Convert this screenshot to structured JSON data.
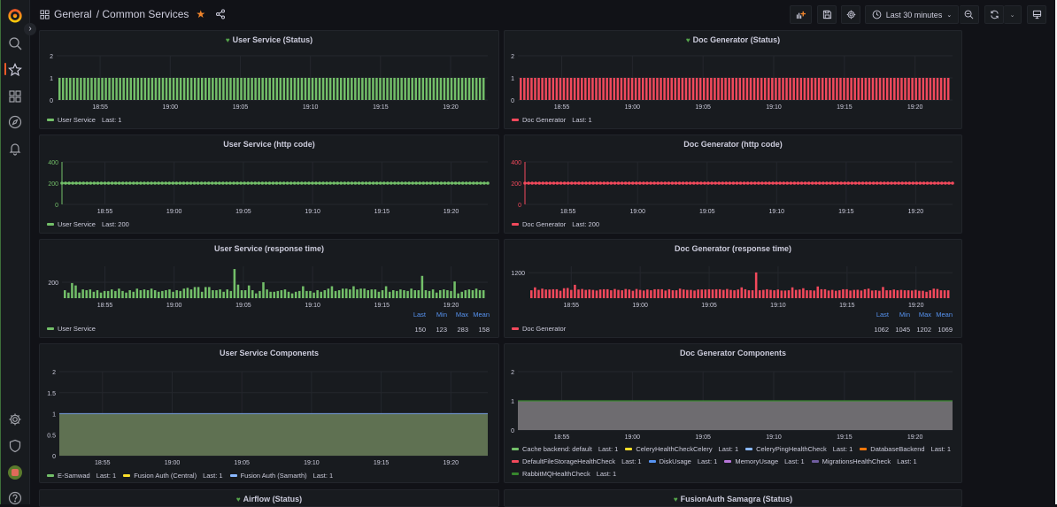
{
  "header": {
    "folder": "General",
    "title": "/ Common Services",
    "starred": true,
    "time_range": "Last 30 minutes"
  },
  "sidebar": {
    "items": [
      {
        "icon": "search-icon",
        "label": "Search"
      },
      {
        "icon": "star-icon",
        "label": "Starred",
        "active": true
      },
      {
        "icon": "dashboards-icon",
        "label": "Dashboards"
      },
      {
        "icon": "compass-icon",
        "label": "Explore"
      },
      {
        "icon": "bell-icon",
        "label": "Alerting"
      },
      {
        "icon": "gear-icon",
        "label": "Configuration"
      },
      {
        "icon": "shield-icon",
        "label": "Server Admin"
      },
      {
        "icon": "avatar",
        "label": "Profile"
      },
      {
        "icon": "help-icon",
        "label": "Help"
      }
    ]
  },
  "colors": {
    "green": "#73bf69",
    "red": "#f2495c",
    "accent": "#f05a28",
    "legend_header": "#5794f2"
  },
  "x_ticks": [
    "18:55",
    "19:00",
    "19:05",
    "19:10",
    "19:15",
    "19:20"
  ],
  "chart_data": [
    {
      "id": "user-status",
      "type": "bar",
      "title": "User Service (Status)",
      "heart": true,
      "color": "#73bf69",
      "ylim": [
        0,
        2
      ],
      "yticks": [
        "0",
        "1",
        "2"
      ],
      "series": [
        {
          "name": "User Service",
          "legend": "Last: 1",
          "value_constant": 1,
          "points": 120
        }
      ]
    },
    {
      "id": "doc-status",
      "type": "bar",
      "title": "Doc Generator (Status)",
      "heart": true,
      "color": "#f2495c",
      "ylim": [
        0,
        2
      ],
      "yticks": [
        "0",
        "1",
        "2"
      ],
      "series": [
        {
          "name": "Doc Generator",
          "legend": "Last: 1",
          "value_constant": 1,
          "points": 120
        }
      ]
    },
    {
      "id": "user-http",
      "type": "line",
      "title": "User Service (http code)",
      "color": "#73bf69",
      "ylim": [
        0,
        400
      ],
      "yticks": [
        "0",
        "200",
        "400"
      ],
      "series": [
        {
          "name": "User Service",
          "legend": "Last: 200",
          "value_constant": 200,
          "points": 120
        }
      ]
    },
    {
      "id": "doc-http",
      "type": "line",
      "title": "Doc Generator (http code)",
      "color": "#f2495c",
      "ylim": [
        0,
        400
      ],
      "yticks": [
        "0",
        "200",
        "400"
      ],
      "series": [
        {
          "name": "Doc Generator",
          "legend": "Last: 200",
          "value_constant": 200,
          "points": 120
        }
      ]
    },
    {
      "id": "user-resp",
      "type": "bar",
      "title": "User Service (response time)",
      "color": "#73bf69",
      "ylim": [
        100,
        300
      ],
      "yticks": [
        "200"
      ],
      "ytick_values": [
        200
      ],
      "series": [
        {
          "name": "User Service",
          "values": [
            150,
            135,
            195,
            180,
            135,
            155,
            150,
            155,
            140,
            150,
            135,
            145,
            145,
            155,
            145,
            160,
            145,
            135,
            150,
            140,
            160,
            150,
            155,
            150,
            160,
            150,
            140,
            145,
            150,
            155,
            140,
            150,
            145,
            160,
            165,
            155,
            170,
            170,
            140,
            170,
            170,
            150,
            150,
            155,
            140,
            155,
            145,
            283,
            185,
            150,
            150,
            180,
            150,
            130,
            145,
            200,
            155,
            140,
            140,
            145,
            150,
            155,
            140,
            130,
            140,
            145,
            175,
            145,
            145,
            135,
            150,
            140,
            150,
            160,
            175,
            145,
            150,
            160,
            160,
            155,
            175,
            155,
            160,
            160,
            150,
            155,
            155,
            140,
            150,
            175,
            140,
            150,
            145,
            155,
            150,
            145,
            160,
            150,
            150,
            240,
            150,
            145,
            155,
            135,
            150,
            155,
            150,
            145,
            205,
            130,
            140,
            150,
            155,
            150,
            160,
            150,
            150
          ]
        }
      ],
      "stats": {
        "headers": [
          "Last",
          "Min",
          "Max",
          "Mean"
        ],
        "values": [
          "150",
          "123",
          "283",
          "158"
        ]
      }
    },
    {
      "id": "doc-resp",
      "type": "bar",
      "title": "Doc Generator (response time)",
      "color": "#f2495c",
      "ylim": [
        1000,
        1250
      ],
      "yticks": [
        "1200"
      ],
      "ytick_values": [
        1200
      ],
      "series": [
        {
          "name": "Doc Generator",
          "values": [
            1062,
            1085,
            1065,
            1075,
            1068,
            1068,
            1070,
            1070,
            1058,
            1078,
            1080,
            1065,
            1105,
            1068,
            1072,
            1065,
            1068,
            1065,
            1060,
            1068,
            1070,
            1070,
            1062,
            1072,
            1065,
            1062,
            1072,
            1068,
            1058,
            1072,
            1065,
            1060,
            1068,
            1062,
            1070,
            1070,
            1070,
            1060,
            1070,
            1062,
            1062,
            1075,
            1068,
            1065,
            1065,
            1060,
            1068,
            1068,
            1068,
            1070,
            1068,
            1070,
            1070,
            1065,
            1072,
            1065,
            1062,
            1068,
            1085,
            1070,
            1062,
            1062,
            1202,
            1062,
            1065,
            1070,
            1065,
            1062,
            1068,
            1060,
            1060,
            1062,
            1085,
            1065,
            1068,
            1078,
            1062,
            1062,
            1060,
            1092,
            1070,
            1070,
            1060,
            1065,
            1058,
            1062,
            1070,
            1070,
            1060,
            1065,
            1066,
            1060,
            1070,
            1075,
            1060,
            1062,
            1058,
            1088,
            1062,
            1062,
            1068,
            1062,
            1065,
            1062,
            1062,
            1060,
            1065,
            1058,
            1058,
            1050,
            1062,
            1075,
            1072,
            1062,
            1062,
            1062
          ]
        }
      ],
      "stats": {
        "headers": [
          "Last",
          "Min",
          "Max",
          "Mean"
        ],
        "values": [
          "1062",
          "1045",
          "1202",
          "1069"
        ]
      }
    },
    {
      "id": "user-components",
      "type": "area",
      "title": "User Service Components",
      "fill": "#5f7152",
      "line": "#6b8dc2",
      "ylim": [
        0,
        2
      ],
      "yticks": [
        "0",
        "0.5",
        "1",
        "1.5",
        "2"
      ],
      "series": [
        {
          "name": "E-Samwad",
          "legend": "Last: 1",
          "color": "#73bf69",
          "value_constant": 1
        },
        {
          "name": "Fusion Auth (Central)",
          "legend": "Last: 1",
          "color": "#fade2a",
          "value_constant": 1
        },
        {
          "name": "Fusion Auth (Samarth)",
          "legend": "Last: 1",
          "color": "#8ab8ff",
          "value_constant": 1
        }
      ]
    },
    {
      "id": "doc-components",
      "type": "area",
      "title": "Doc Generator Components",
      "fill": "#6e6c70",
      "line": "#37872d",
      "ylim": [
        0,
        2
      ],
      "yticks": [
        "0",
        "1",
        "2"
      ],
      "series": [
        {
          "name": "Cache backend: default",
          "legend": "Last: 1",
          "color": "#73bf69",
          "value_constant": 1
        },
        {
          "name": "CeleryHealthCheckCelery",
          "legend": "Last: 1",
          "color": "#fade2a",
          "value_constant": 1
        },
        {
          "name": "CeleryPingHealthCheck",
          "legend": "Last: 1",
          "color": "#8ab8ff",
          "value_constant": 1
        },
        {
          "name": "DatabaseBackend",
          "legend": "Last: 1",
          "color": "#ff780a",
          "value_constant": 1
        },
        {
          "name": "DefaultFileStorageHealthCheck",
          "legend": "Last: 1",
          "color": "#f2495c",
          "value_constant": 1
        },
        {
          "name": "DiskUsage",
          "legend": "Last: 1",
          "color": "#5794f2",
          "value_constant": 1
        },
        {
          "name": "MemoryUsage",
          "legend": "Last: 1",
          "color": "#b877d9",
          "value_constant": 1
        },
        {
          "name": "MigrationsHealthCheck",
          "legend": "Last: 1",
          "color": "#705da0",
          "value_constant": 1
        },
        {
          "name": "RabbitMQHealthCheck",
          "legend": "Last: 1",
          "color": "#37872d",
          "value_constant": 1
        }
      ]
    }
  ],
  "bottom_panels": [
    {
      "title": "Airflow (Status)",
      "heart": true
    },
    {
      "title": "FusionAuth Samagra (Status)",
      "heart": true
    }
  ]
}
